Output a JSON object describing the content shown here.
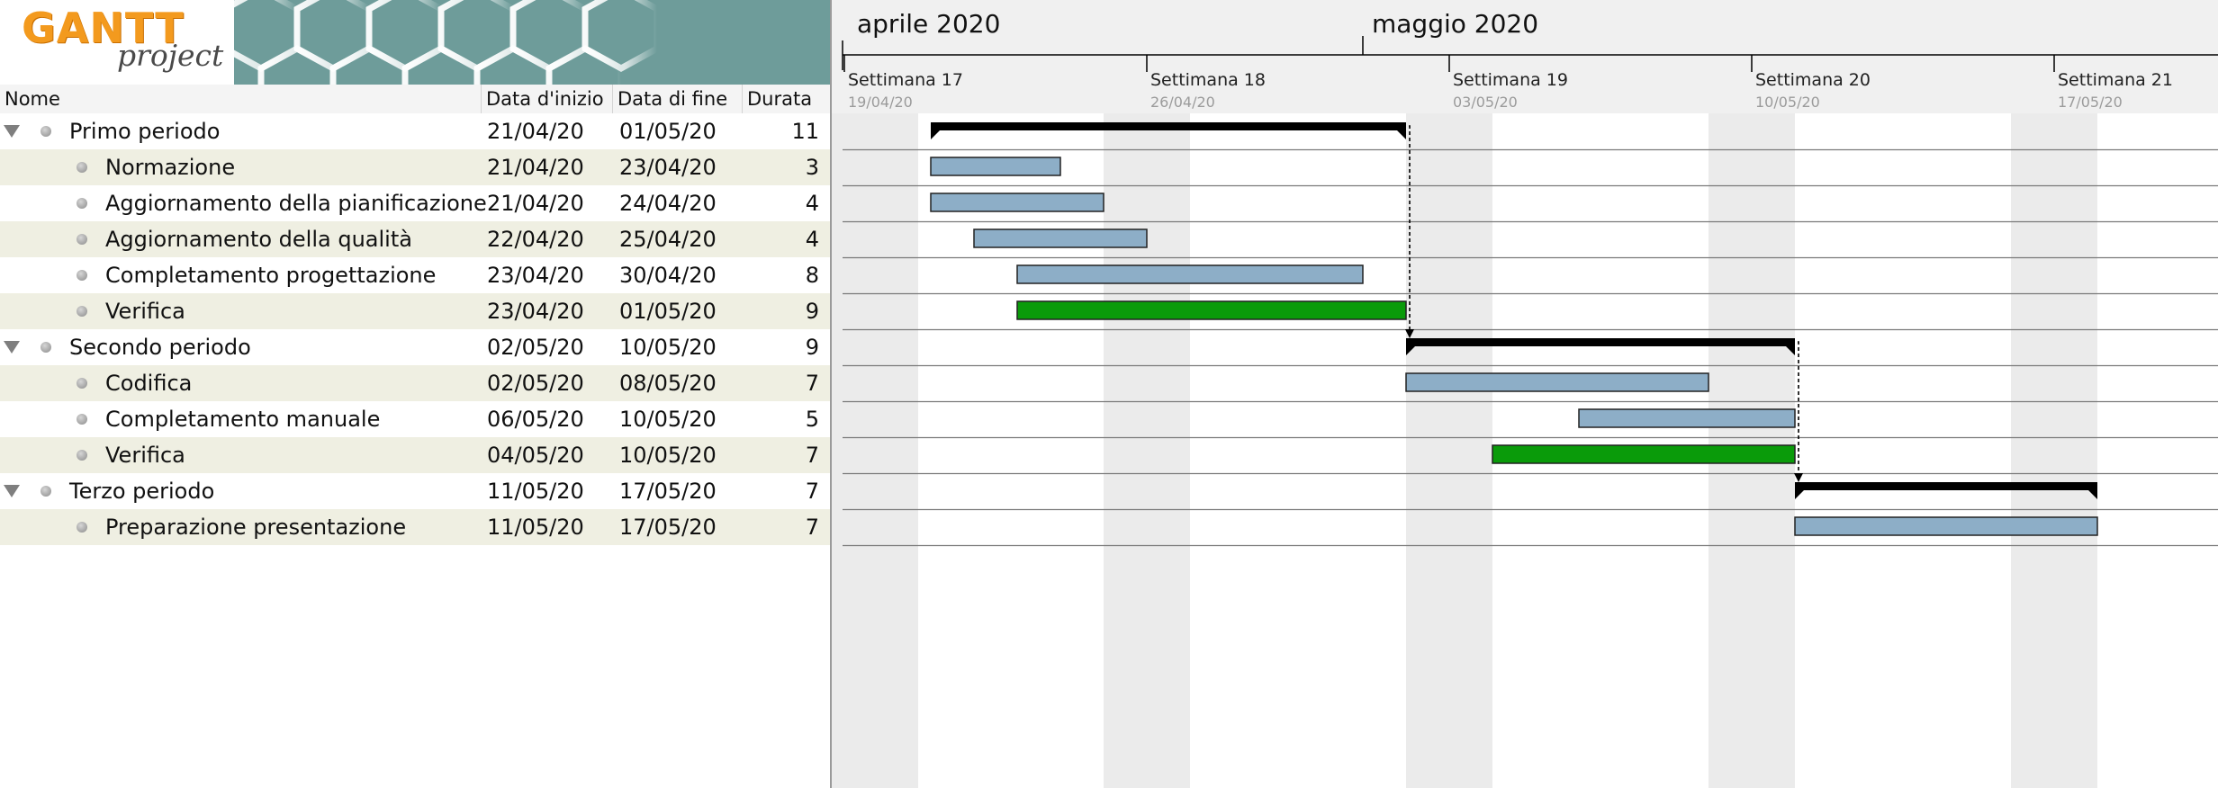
{
  "logo": {
    "gantt": "GANTT",
    "project": "project"
  },
  "table": {
    "columns": {
      "name": "Nome",
      "start": "Data d'inizio",
      "end": "Data di fine",
      "duration": "Durata"
    },
    "rows": [
      {
        "name": "Primo periodo",
        "start": "21/04/20",
        "end": "01/05/20",
        "duration": "11",
        "level": 0
      },
      {
        "name": "Normazione",
        "start": "21/04/20",
        "end": "23/04/20",
        "duration": "3",
        "level": 1
      },
      {
        "name": "Aggiornamento della pianificazione",
        "start": "21/04/20",
        "end": "24/04/20",
        "duration": "4",
        "level": 1
      },
      {
        "name": "Aggiornamento della qualità",
        "start": "22/04/20",
        "end": "25/04/20",
        "duration": "4",
        "level": 1
      },
      {
        "name": "Completamento progettazione",
        "start": "23/04/20",
        "end": "30/04/20",
        "duration": "8",
        "level": 1
      },
      {
        "name": "Verifica",
        "start": "23/04/20",
        "end": "01/05/20",
        "duration": "9",
        "level": 1
      },
      {
        "name": "Secondo periodo",
        "start": "02/05/20",
        "end": "10/05/20",
        "duration": "9",
        "level": 0
      },
      {
        "name": "Codifica",
        "start": "02/05/20",
        "end": "08/05/20",
        "duration": "7",
        "level": 1
      },
      {
        "name": "Completamento manuale",
        "start": "06/05/20",
        "end": "10/05/20",
        "duration": "5",
        "level": 1
      },
      {
        "name": "Verifica",
        "start": "04/05/20",
        "end": "10/05/20",
        "duration": "7",
        "level": 1
      },
      {
        "name": "Terzo periodo",
        "start": "11/05/20",
        "end": "17/05/20",
        "duration": "7",
        "level": 0
      },
      {
        "name": "Preparazione presentazione",
        "start": "11/05/20",
        "end": "17/05/20",
        "duration": "7",
        "level": 1
      }
    ]
  },
  "timeline": {
    "months": [
      "aprile 2020",
      "maggio 2020"
    ],
    "weeks": [
      {
        "label": "Settimana  17",
        "date": "19/04/20"
      },
      {
        "label": "Settimana  18",
        "date": "26/04/20"
      },
      {
        "label": "Settimana  19",
        "date": "03/05/20"
      },
      {
        "label": "Settimana  20",
        "date": "10/05/20"
      },
      {
        "label": "Settimana  21",
        "date": "17/05/20"
      }
    ]
  },
  "colors": {
    "task": "#8daec7",
    "milestone_task": "#0a9b0a",
    "summary": "#000000",
    "weekend": "#ebebeb",
    "logo_bg": "#6e9c9a"
  },
  "icons": [
    "expand-triangle-icon",
    "task-bullet-icon"
  ]
}
